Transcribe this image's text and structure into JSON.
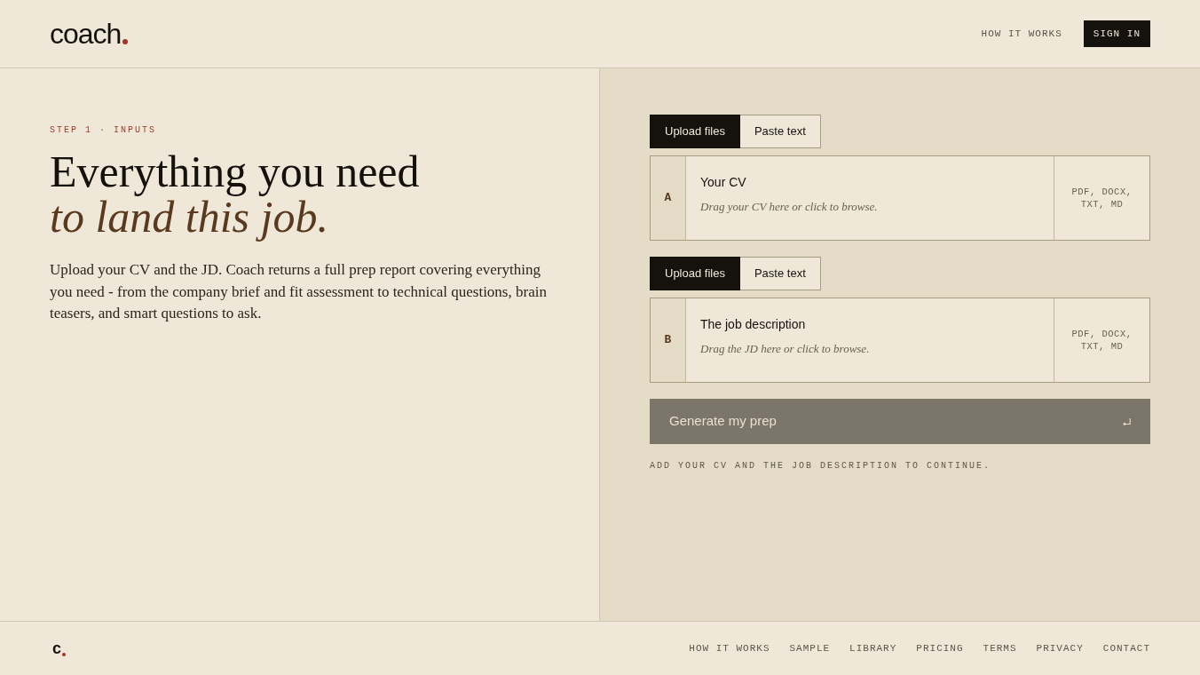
{
  "header": {
    "logo": "coach",
    "nav": [
      {
        "label": "HOW IT WORKS",
        "kind": "link"
      },
      {
        "label": "SIGN IN",
        "kind": "button"
      }
    ]
  },
  "intro": {
    "eyebrow": "STEP 1 · INPUTS",
    "headline": "Everything you need",
    "headline_accent": "to land this job.",
    "body": "Upload your CV and the JD. Coach returns a full prep report covering everything you need - from the company brief and fit assessment to technical questions, brain teasers, and smart questions to ask."
  },
  "inputs": [
    {
      "tabs": [
        {
          "label": "Upload files",
          "selected": true
        },
        {
          "label": "Paste text",
          "selected": false
        }
      ],
      "letter": "A",
      "title": "Your CV",
      "hint": "Drag your CV here or click to browse.",
      "formats": "PDF, DOCX, TXT, MD"
    },
    {
      "tabs": [
        {
          "label": "Upload files",
          "selected": true
        },
        {
          "label": "Paste text",
          "selected": false
        }
      ],
      "letter": "B",
      "title": "The job description",
      "hint": "Drag the JD here or click to browse.",
      "formats": "PDF, DOCX, TXT, MD"
    }
  ],
  "generate": {
    "label": "Generate my prep",
    "disabled": true
  },
  "notice": "ADD YOUR CV AND THE JOB DESCRIPTION TO CONTINUE.",
  "footer": {
    "logo": "c",
    "links": [
      "HOW IT WORKS",
      "SAMPLE",
      "LIBRARY",
      "PRICING",
      "TERMS",
      "PRIVACY",
      "CONTACT"
    ]
  }
}
